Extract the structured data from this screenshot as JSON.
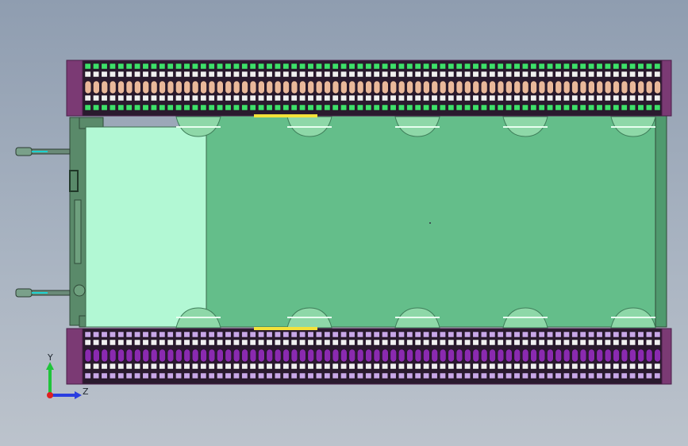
{
  "viewport": {
    "background_top": "#8f9db0",
    "background_bottom": "#bcc3cc"
  },
  "model": {
    "colors": {
      "frame": "#7b3a74",
      "frame_dark": "#4a1d48",
      "track_top_light": "#e9b89a",
      "track_top_green": "#3ee06a",
      "track_bottom_light": "#c9a8e8",
      "track_bottom_purple": "#8a2ab0",
      "track_dark": "#2a1a2e",
      "hull_main": "#64be8a",
      "hull_light": "#b2f8d4",
      "wheel": "#8ed8a8",
      "wheel_dark": "#3f7e5a",
      "rear_plate": "#5a8a6a",
      "yellow_strip": "#f4e23a"
    },
    "road_wheels_per_side": 5,
    "track_links_per_side": 70,
    "rear_rods": 2
  },
  "triad": {
    "y_label": "Y",
    "z_label": "Z",
    "y_color": "#1fc43a",
    "z_color": "#2a3ee0",
    "x_color": "#e02020"
  }
}
